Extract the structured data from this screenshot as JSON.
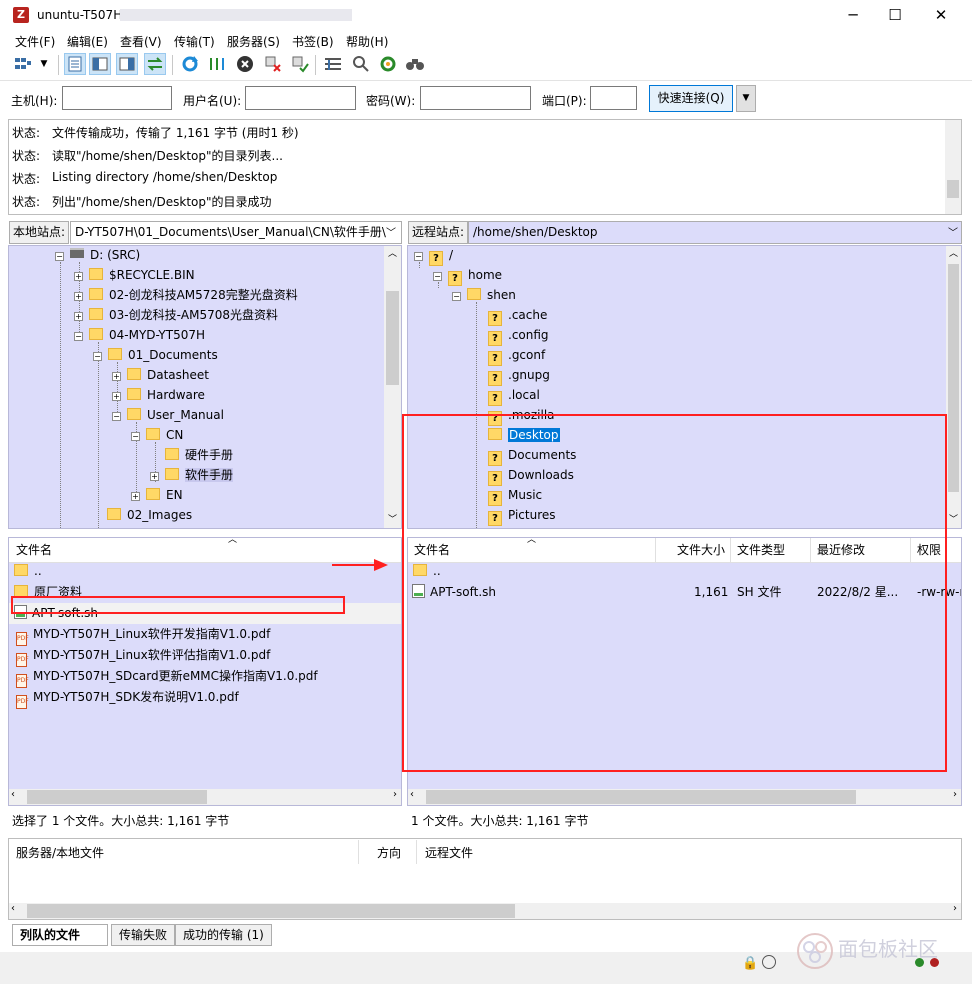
{
  "window": {
    "title": "ununtu-T507H",
    "minimize": "─",
    "maximize": "☐",
    "close": "✕"
  },
  "menu": [
    "文件(F)",
    "编辑(E)",
    "查看(V)",
    "传输(T)",
    "服务器(S)",
    "书签(B)",
    "帮助(H)"
  ],
  "toolbar_icons": [
    "site-manager-icon",
    "dropdown-icon",
    "toggle-log-icon",
    "toggle-local-tree-icon",
    "toggle-remote-tree-icon",
    "toggle-queue-icon",
    "refresh-icon",
    "process-queue-icon",
    "cancel-icon",
    "disconnect-icon",
    "reconnect-icon",
    "filter-icon",
    "compare-icon",
    "sync-browse-icon",
    "search-icon"
  ],
  "quickconnect": {
    "host_label": "主机(H):",
    "user_label": "用户名(U):",
    "pass_label": "密码(W):",
    "port_label": "端口(P):",
    "host_value": "",
    "user_value": "",
    "pass_value": "",
    "port_value": "",
    "button": "快速连接(Q)"
  },
  "log": [
    {
      "label": "状态:",
      "msg": "文件传输成功，传输了 1,161 字节 (用时1 秒)"
    },
    {
      "label": "状态:",
      "msg": "读取\"/home/shen/Desktop\"的目录列表..."
    },
    {
      "label": "状态:",
      "msg": "Listing directory /home/shen/Desktop"
    },
    {
      "label": "状态:",
      "msg": "列出\"/home/shen/Desktop\"的目录成功"
    }
  ],
  "local": {
    "site_label": "本地站点:",
    "path": "D-YT507H\\01_Documents\\User_Manual\\CN\\软件手册\\",
    "tree": [
      {
        "label": "D: (SRC)",
        "type": "drive"
      },
      {
        "label": "$RECYCLE.BIN",
        "type": "folder"
      },
      {
        "label": "02-创龙科技AM5728完整光盘资料",
        "type": "folder"
      },
      {
        "label": "03-创龙科技-AM5708光盘资料",
        "type": "folder"
      },
      {
        "label": "04-MYD-YT507H",
        "type": "folder"
      },
      {
        "label": "01_Documents",
        "type": "folder"
      },
      {
        "label": "Datasheet",
        "type": "folder"
      },
      {
        "label": "Hardware",
        "type": "folder"
      },
      {
        "label": "User_Manual",
        "type": "folder"
      },
      {
        "label": "CN",
        "type": "folder"
      },
      {
        "label": "硬件手册",
        "type": "folder"
      },
      {
        "label": "软件手册",
        "type": "folder"
      },
      {
        "label": "EN",
        "type": "folder"
      },
      {
        "label": "02_Images",
        "type": "folder"
      }
    ],
    "list_header": "文件名",
    "files": [
      {
        "name": "..",
        "type": "folder"
      },
      {
        "name": "原厂资料",
        "type": "folder"
      },
      {
        "name": "APT-soft.sh",
        "type": "sh"
      },
      {
        "name": "MYD-YT507H_Linux软件开发指南V1.0.pdf",
        "type": "pdf"
      },
      {
        "name": "MYD-YT507H_Linux软件评估指南V1.0.pdf",
        "type": "pdf"
      },
      {
        "name": "MYD-YT507H_SDcard更新eMMC操作指南V1.0.pdf",
        "type": "pdf"
      },
      {
        "name": "MYD-YT507H_SDK发布说明V1.0.pdf",
        "type": "pdf"
      }
    ],
    "status": "选择了 1 个文件。大小总共: 1,161 字节"
  },
  "remote": {
    "site_label": "远程站点:",
    "path": "/home/shen/Desktop",
    "tree": [
      {
        "label": "/",
        "type": "q"
      },
      {
        "label": "home",
        "type": "q"
      },
      {
        "label": "shen",
        "type": "folder"
      },
      {
        "label": ".cache",
        "type": "q"
      },
      {
        "label": ".config",
        "type": "q"
      },
      {
        "label": ".gconf",
        "type": "q"
      },
      {
        "label": ".gnupg",
        "type": "q"
      },
      {
        "label": ".local",
        "type": "q"
      },
      {
        "label": ".mozilla",
        "type": "q"
      },
      {
        "label": "Desktop",
        "type": "folder"
      },
      {
        "label": "Documents",
        "type": "q"
      },
      {
        "label": "Downloads",
        "type": "q"
      },
      {
        "label": "Music",
        "type": "q"
      },
      {
        "label": "Pictures",
        "type": "q"
      }
    ],
    "columns": [
      "文件名",
      "文件大小",
      "文件类型",
      "最近修改",
      "权限"
    ],
    "files": [
      {
        "name": "..",
        "size": "",
        "type": "",
        "modified": "",
        "perm": ""
      },
      {
        "name": "APT-soft.sh",
        "size": "1,161",
        "type": "SH 文件",
        "modified": "2022/8/2 星...",
        "perm": "-rw-rw-r"
      }
    ],
    "status": "1 个文件。大小总共: 1,161 字节"
  },
  "queue": {
    "col_server": "服务器/本地文件",
    "col_direction": "方向",
    "col_remote": "远程文件",
    "tabs": [
      "列队的文件",
      "传输失败",
      "成功的传输 (1)"
    ]
  },
  "watermark": "面包板社区"
}
